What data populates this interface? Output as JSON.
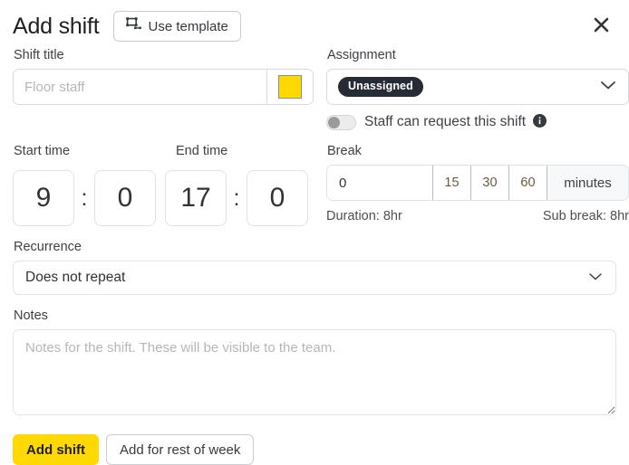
{
  "dialog": {
    "title": "Add shift",
    "use_template_label": "Use template",
    "close_icon": "close-icon",
    "template_icon": "template-icon"
  },
  "shift_title": {
    "label": "Shift title",
    "value": "",
    "placeholder": "Floor staff",
    "color_swatch": "#ffd900"
  },
  "assignment": {
    "label": "Assignment",
    "selected": "Unassigned",
    "chevron_icon": "chevron-down-icon",
    "toggle_label": "Staff can request this shift",
    "toggle_on": false,
    "info_icon": "info-icon"
  },
  "time": {
    "start_label": "Start time",
    "end_label": "End time",
    "separator": ":",
    "start_hour": "9",
    "start_minute": "0",
    "end_hour": "17",
    "end_minute": "0"
  },
  "break": {
    "label": "Break",
    "value": "0",
    "presets": [
      "15",
      "30",
      "60"
    ],
    "unit": "minutes",
    "duration_text": "Duration: 8hr",
    "sub_break_text": "Sub break: 8hr"
  },
  "recurrence": {
    "label": "Recurrence",
    "selected": "Does not repeat",
    "chevron_icon": "chevron-down-icon"
  },
  "notes": {
    "label": "Notes",
    "value": "",
    "placeholder": "Notes for the shift. These will be visible to the team."
  },
  "footer": {
    "primary_label": "Add shift",
    "secondary_label": "Add for rest of week"
  },
  "colors": {
    "accent": "#ffd900",
    "pill_bg": "#272b35",
    "border": "#d7dbe0"
  }
}
